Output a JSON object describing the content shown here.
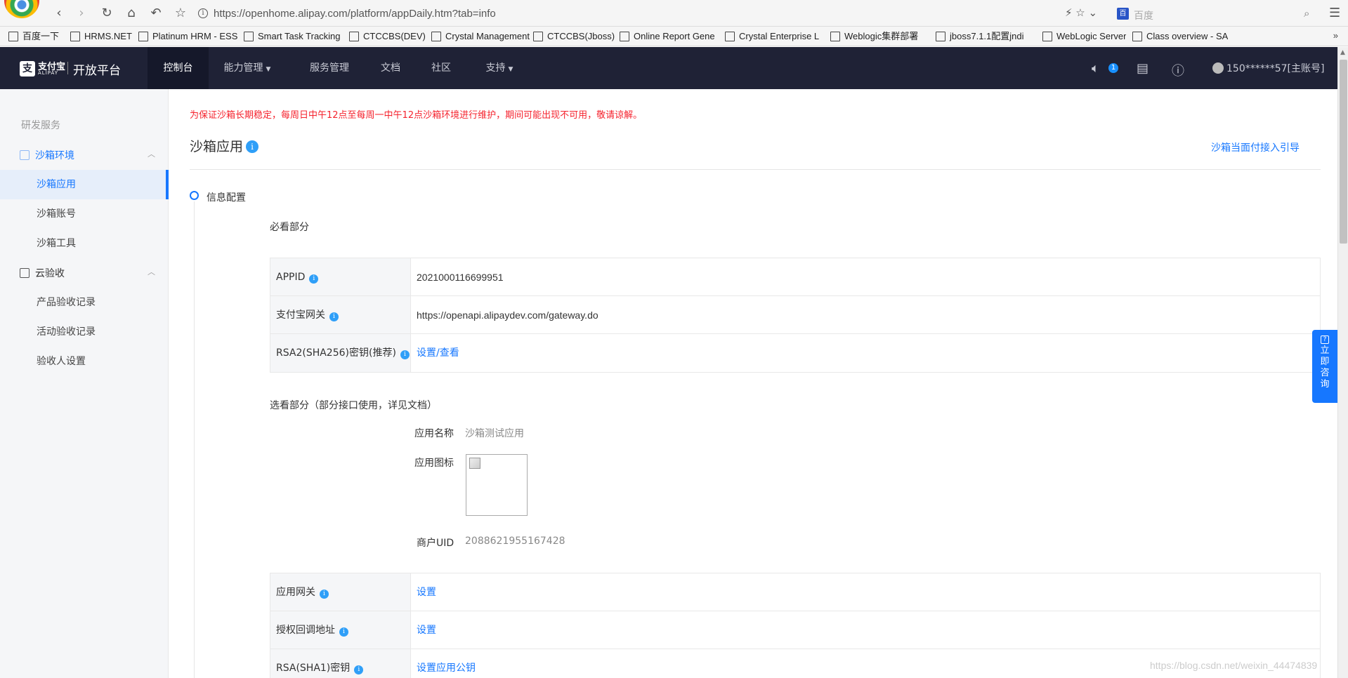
{
  "browser": {
    "url": "https://openhome.alipay.com/platform/appDaily.htm?tab=info",
    "search_engine": "百度"
  },
  "bookmarks": [
    "百度一下",
    "HRMS.NET",
    "Platinum HRM - ESS",
    "Smart Task Tracking",
    "CTCCBS(DEV)",
    "Crystal Management",
    "CTCCBS(Jboss)",
    "Online Report Gene",
    "Crystal Enterprise L",
    "Weblogic集群部署",
    "jboss7.1.1配置jndi",
    "WebLogic Server",
    "Class overview - SA"
  ],
  "topnav": {
    "brand_logo": "支",
    "brand_alipay": "支付宝",
    "brand_alipay_sub": "ALIPAY",
    "brand_name": "开放平台",
    "items": [
      {
        "label": "控制台",
        "dropdown": false,
        "active": true
      },
      {
        "label": "能力管理",
        "dropdown": true,
        "active": false
      },
      {
        "label": "服务管理",
        "dropdown": false,
        "active": false
      },
      {
        "label": "文档",
        "dropdown": false,
        "active": false
      },
      {
        "label": "社区",
        "dropdown": false,
        "active": false
      },
      {
        "label": "支持",
        "dropdown": true,
        "active": false
      }
    ],
    "notification_count": "1",
    "account": "150******57[主账号]"
  },
  "sidebar": {
    "section": "研发服务",
    "groups": [
      {
        "label": "沙箱环境",
        "icon": "cube-icon",
        "items": [
          "沙箱应用",
          "沙箱账号",
          "沙箱工具"
        ]
      },
      {
        "label": "云验收",
        "icon": "document-check-icon",
        "items": [
          "产品验收记录",
          "活动验收记录",
          "验收人设置"
        ]
      }
    ],
    "active_item": "沙箱应用"
  },
  "main": {
    "notice": "为保证沙箱长期稳定，每周日中午12点至每周一中午12点沙箱环境进行维护，期间可能出现不可用，敬请谅解。",
    "title": "沙箱应用",
    "guide_link": "沙箱当面付接入引导",
    "step": "信息配置",
    "required_heading": "必看部分",
    "required_rows": [
      {
        "key": "APPID",
        "value": "2021000116699951",
        "link": false
      },
      {
        "key": "支付宝网关",
        "value": "https://openapi.alipaydev.com/gateway.do",
        "link": false
      },
      {
        "key": "RSA2(SHA256)密钥(推荐)",
        "value": "设置/查看",
        "link": true
      }
    ],
    "optional_heading": "选看部分（部分接口使用，详见文档）",
    "app_name_label": "应用名称",
    "app_name_value": "沙箱测试应用",
    "app_icon_label": "应用图标",
    "merchant_uid_label": "商户UID",
    "merchant_uid_value": "2088621955167428",
    "config_rows": [
      {
        "key": "应用网关",
        "value": "设置",
        "link": true
      },
      {
        "key": "授权回调地址",
        "value": "设置",
        "link": true
      },
      {
        "key": "RSA(SHA1)密钥",
        "value": "设置应用公钥",
        "link": true
      }
    ]
  },
  "consult_button": [
    "立",
    "即",
    "咨",
    "询"
  ],
  "watermark": "https://blog.csdn.net/weixin_44474839",
  "colors": {
    "accent": "#1677ff",
    "nav_bg": "#1f2236",
    "notice": "#f5222d"
  }
}
